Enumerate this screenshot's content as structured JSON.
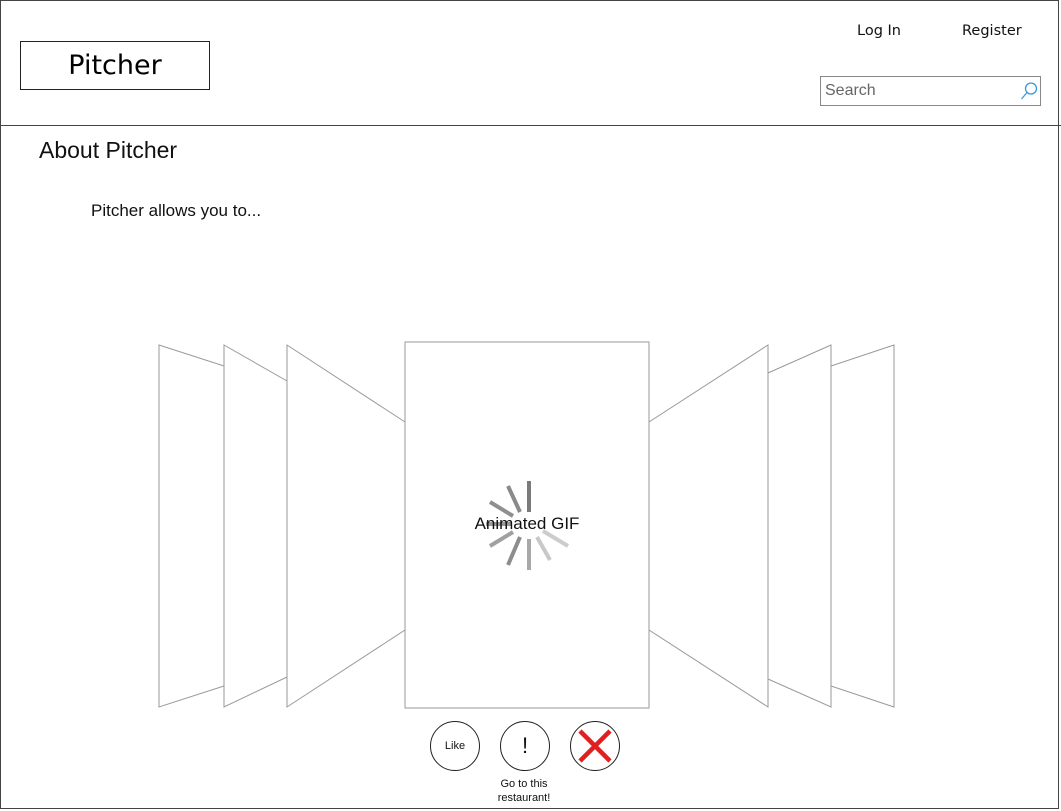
{
  "header": {
    "logo": "Pitcher",
    "nav": {
      "login_label": "Log In",
      "register_label": "Register"
    },
    "search": {
      "placeholder": "Search",
      "value": "",
      "icon": "search-icon"
    }
  },
  "main": {
    "title": "About Pitcher",
    "intro": "Pitcher allows you to...",
    "carousel": {
      "center_card_label": "Animated GIF",
      "loading_icon": "spinner-icon"
    },
    "actions": {
      "like_label": "Like",
      "go_label": "!",
      "go_caption": "Go to this restaurant!",
      "dismiss_icon": "close-icon",
      "dismiss_color": "#e02020"
    }
  }
}
